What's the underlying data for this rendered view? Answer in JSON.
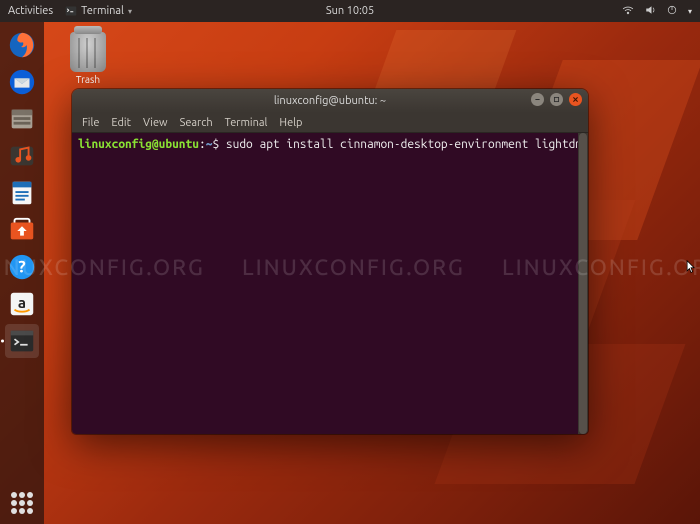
{
  "topbar": {
    "activities": "Activities",
    "app_name": "Terminal",
    "clock": "Sun 10:05",
    "indicators": {
      "network": "net",
      "volume": "vol",
      "power": "pwr"
    }
  },
  "dock": {
    "items": [
      {
        "name": "firefox"
      },
      {
        "name": "thunderbird"
      },
      {
        "name": "files"
      },
      {
        "name": "rhythmbox"
      },
      {
        "name": "libreoffice-writer"
      },
      {
        "name": "ubuntu-software"
      },
      {
        "name": "help"
      },
      {
        "name": "amazon"
      },
      {
        "name": "terminal",
        "active": true
      }
    ]
  },
  "desktop": {
    "trash_label": "Trash"
  },
  "terminal": {
    "title": "linuxconfig@ubuntu: ~",
    "menu": [
      "File",
      "Edit",
      "View",
      "Search",
      "Terminal",
      "Help"
    ],
    "prompt_user": "linuxconfig@ubuntu",
    "prompt_colon": ":",
    "prompt_path": "~",
    "prompt_symbol": "$ ",
    "command": "sudo apt install cinnamon-desktop-environment lightdm"
  },
  "watermark": "LINUXCONFIG.ORG"
}
